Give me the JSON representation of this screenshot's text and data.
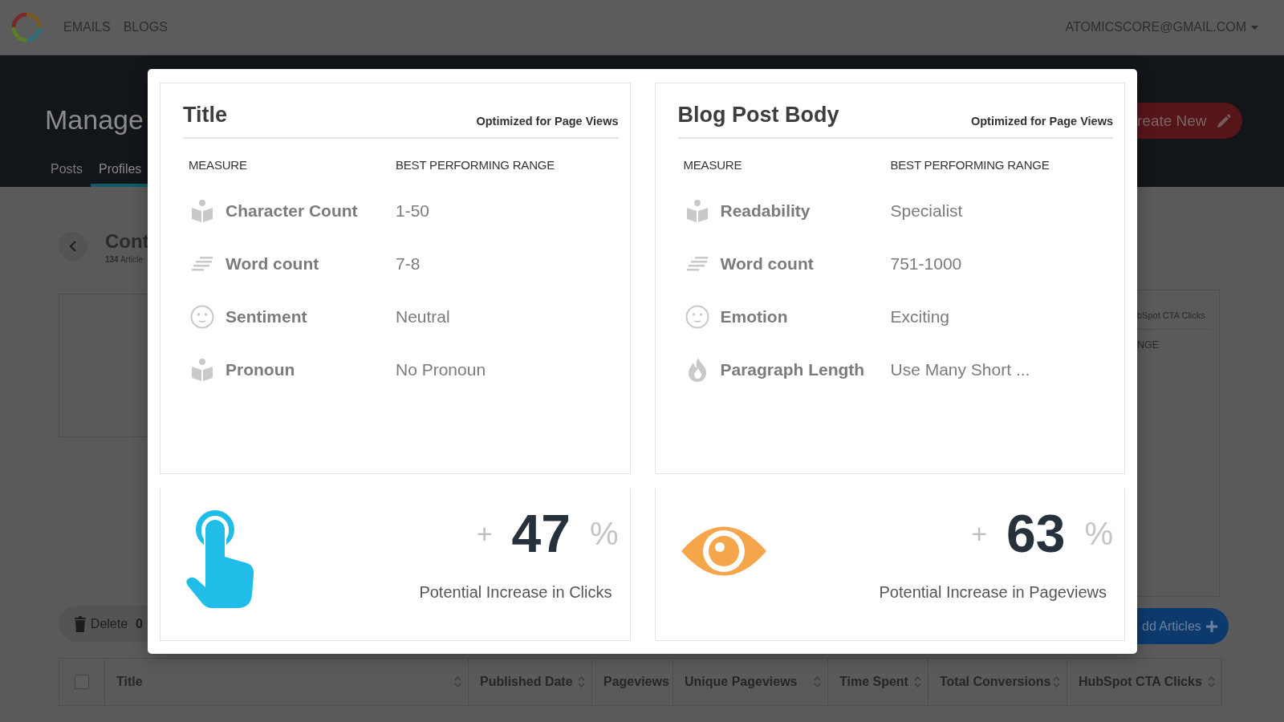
{
  "nav": {
    "links": [
      {
        "label": "EMAILS"
      },
      {
        "label": "BLOGS"
      }
    ],
    "account": "ATOMICSCORE@GMAIL.COM"
  },
  "header": {
    "title": "Manage",
    "tabs": [
      {
        "label": "Posts",
        "selected": false
      },
      {
        "label": "Profiles",
        "selected": true
      }
    ],
    "create_button": "reate New"
  },
  "content": {
    "title": "Cont",
    "count": "**134** Article",
    "delete_button": "Delete",
    "delete_count": "0",
    "add_button": "dd Articles"
  },
  "side_panel": {
    "heading": "bSpot CTA Clicks",
    "column": "NGE"
  },
  "table": {
    "select_all": {
      "checked": false
    },
    "columns": [
      {
        "label": "Title"
      },
      {
        "label": "Published Date"
      },
      {
        "label": "Pageviews"
      },
      {
        "label": "Unique Pageviews"
      },
      {
        "label": "Time Spent"
      },
      {
        "label": "Total Conversions"
      },
      {
        "label": "HubSpot CTA Clicks"
      }
    ]
  },
  "modal": {
    "cards": [
      {
        "title": "Title",
        "subtitle": "Optimized for Page Views",
        "columns": [
          "MEASURE",
          "BEST PERFORMING RANGE"
        ],
        "rows": [
          {
            "kind": "book",
            "label": "Character Count",
            "value": "1-50"
          },
          {
            "kind": "lines",
            "label": "Word count",
            "value": "7-8"
          },
          {
            "kind": "smiley",
            "label": "Sentiment",
            "value": "Neutral"
          },
          {
            "kind": "book",
            "label": "Pronoun",
            "value": "No Pronoun"
          }
        ]
      },
      {
        "title": "Blog Post Body",
        "subtitle": "Optimized for Page Views",
        "columns": [
          "MEASURE",
          "BEST PERFORMING RANGE"
        ],
        "rows": [
          {
            "kind": "book",
            "label": "Readability",
            "value": "Specialist"
          },
          {
            "kind": "lines",
            "label": "Word count",
            "value": "751-1000"
          },
          {
            "kind": "smiley",
            "label": "Emotion",
            "value": "Exciting"
          },
          {
            "kind": "flame",
            "label": "Paragraph Length",
            "value": "Use Many Short ..."
          }
        ]
      }
    ],
    "stats": [
      {
        "kind": "hand",
        "sign": "+",
        "value": "47",
        "unit": "%",
        "caption": "Potential Increase in Clicks"
      },
      {
        "kind": "eye",
        "sign": "+",
        "value": "63",
        "unit": "%",
        "caption": "Potential Increase in Pageviews"
      }
    ]
  }
}
